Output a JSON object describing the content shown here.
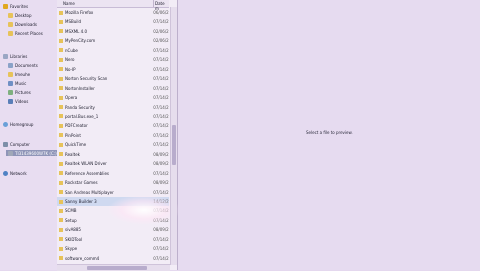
{
  "navigation": {
    "favorites": {
      "label": "Favorites"
    },
    "favorite_items": [
      {
        "label": "Desktop"
      },
      {
        "label": "Downloads"
      },
      {
        "label": "Recent Places"
      }
    ],
    "libraries": {
      "label": "Libraries"
    },
    "library_items": [
      {
        "label": "Documents"
      },
      {
        "label": "Imeuhe"
      },
      {
        "label": "Music"
      },
      {
        "label": "Pictures"
      },
      {
        "label": "Videos"
      }
    ],
    "homegroup": {
      "label": "Homegroup"
    },
    "computer": {
      "label": "Computer"
    },
    "computer_items": [
      {
        "label": "TI31439600W7K (C:)"
      }
    ],
    "network": {
      "label": "Network"
    }
  },
  "file_list": {
    "columns": {
      "name": "Name",
      "date": "Date m"
    },
    "rows": [
      {
        "name": "Mozilla Firefox",
        "date": "06/06/2"
      },
      {
        "name": "MSBuild",
        "date": "07/14/2"
      },
      {
        "name": "MSXML 4.0",
        "date": "02/06/2"
      },
      {
        "name": "MyPenCity.com",
        "date": "02/06/2"
      },
      {
        "name": "nCube",
        "date": "07/14/2"
      },
      {
        "name": "Nero",
        "date": "07/14/2"
      },
      {
        "name": "No-IP",
        "date": "07/14/2"
      },
      {
        "name": "Norton Security Scan",
        "date": "07/14/2"
      },
      {
        "name": "NortonInstaller",
        "date": "07/14/2"
      },
      {
        "name": "Opera",
        "date": "07/14/2"
      },
      {
        "name": "Panda Security",
        "date": "07/14/2"
      },
      {
        "name": "portal.Bus.exe_1",
        "date": "07/14/2"
      },
      {
        "name": "PDFCreator",
        "date": "07/14/2"
      },
      {
        "name": "PinPoint",
        "date": "07/14/2"
      },
      {
        "name": "QuickTime",
        "date": "07/14/2"
      },
      {
        "name": "Realtek",
        "date": "08/09/2"
      },
      {
        "name": "Realtek WLAN Driver",
        "date": "08/09/2"
      },
      {
        "name": "Reference Assemblies",
        "date": "07/14/2"
      },
      {
        "name": "Rockstar Games",
        "date": "08/09/2"
      },
      {
        "name": "San Andreas Multiplayer",
        "date": "07/14/2"
      },
      {
        "name": "Sanny Builder 3",
        "date": "14/12/2"
      },
      {
        "name": "SCMB",
        "date": "07/14/2"
      },
      {
        "name": "Setup",
        "date": "07/14/2"
      },
      {
        "name": "sivA885",
        "date": "08/09/2"
      },
      {
        "name": "SKIDTool",
        "date": "07/14/2"
      },
      {
        "name": "Skype",
        "date": "07/14/2"
      },
      {
        "name": "software_comm4",
        "date": "07/14/2"
      }
    ]
  },
  "preview_pane": {
    "message": "Select a file to preview."
  }
}
